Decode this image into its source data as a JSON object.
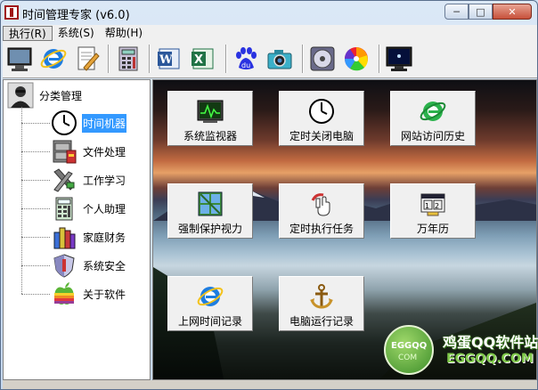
{
  "window": {
    "title": "时间管理专家 (v6.0)"
  },
  "window_controls": {
    "minimize": "─",
    "maximize": "□",
    "close": "✕"
  },
  "menu": [
    {
      "label": "执行(R)"
    },
    {
      "label": "系统(S)"
    },
    {
      "label": "帮助(H)"
    }
  ],
  "toolbar": {
    "buttons": [
      {
        "icon": "monitor-icon"
      },
      {
        "icon": "internet-explorer-icon"
      },
      {
        "icon": "notepad-pen-icon"
      },
      {
        "icon": "calculator-icon"
      },
      {
        "icon": "word-icon"
      },
      {
        "icon": "excel-icon"
      },
      {
        "icon": "baidu-paw-icon"
      },
      {
        "icon": "camera-icon"
      },
      {
        "icon": "media-player-icon"
      },
      {
        "icon": "color-wheel-icon"
      },
      {
        "icon": "screen-icon"
      }
    ]
  },
  "sidebar": {
    "root_label": "分类管理",
    "items": [
      {
        "label": "时间机器",
        "icon": "clock-icon",
        "selected": true
      },
      {
        "label": "文件处理",
        "icon": "file-cabinet-icon",
        "selected": false
      },
      {
        "label": "工作学习",
        "icon": "tools-icon",
        "selected": false
      },
      {
        "label": "个人助理",
        "icon": "calculator-icon",
        "selected": false
      },
      {
        "label": "家庭财务",
        "icon": "books-icon",
        "selected": false
      },
      {
        "label": "系统安全",
        "icon": "shield-icon",
        "selected": false
      },
      {
        "label": "关于软件",
        "icon": "apple-icon",
        "selected": false
      }
    ]
  },
  "main": {
    "tiles": [
      {
        "label": "系统监视器",
        "icon": "monitor-chart-icon"
      },
      {
        "label": "定时关闭电脑",
        "icon": "clock-icon"
      },
      {
        "label": "网站访问历史",
        "icon": "internet-explorer-icon"
      },
      {
        "label": "强制保护视力",
        "icon": "window-grid-icon"
      },
      {
        "label": "定时执行任务",
        "icon": "hand-pointer-icon"
      },
      {
        "label": "万年历",
        "icon": "calendar-icon"
      },
      {
        "label": "上网时间记录",
        "icon": "internet-explorer-icon"
      },
      {
        "label": "电脑运行记录",
        "icon": "anchor-icon"
      }
    ]
  },
  "watermark": {
    "circle_top": "EGGQQ",
    "circle_bottom": "COM",
    "site_name": "鸡蛋QQ软件站",
    "site_url": "EGGQQ.COM"
  }
}
